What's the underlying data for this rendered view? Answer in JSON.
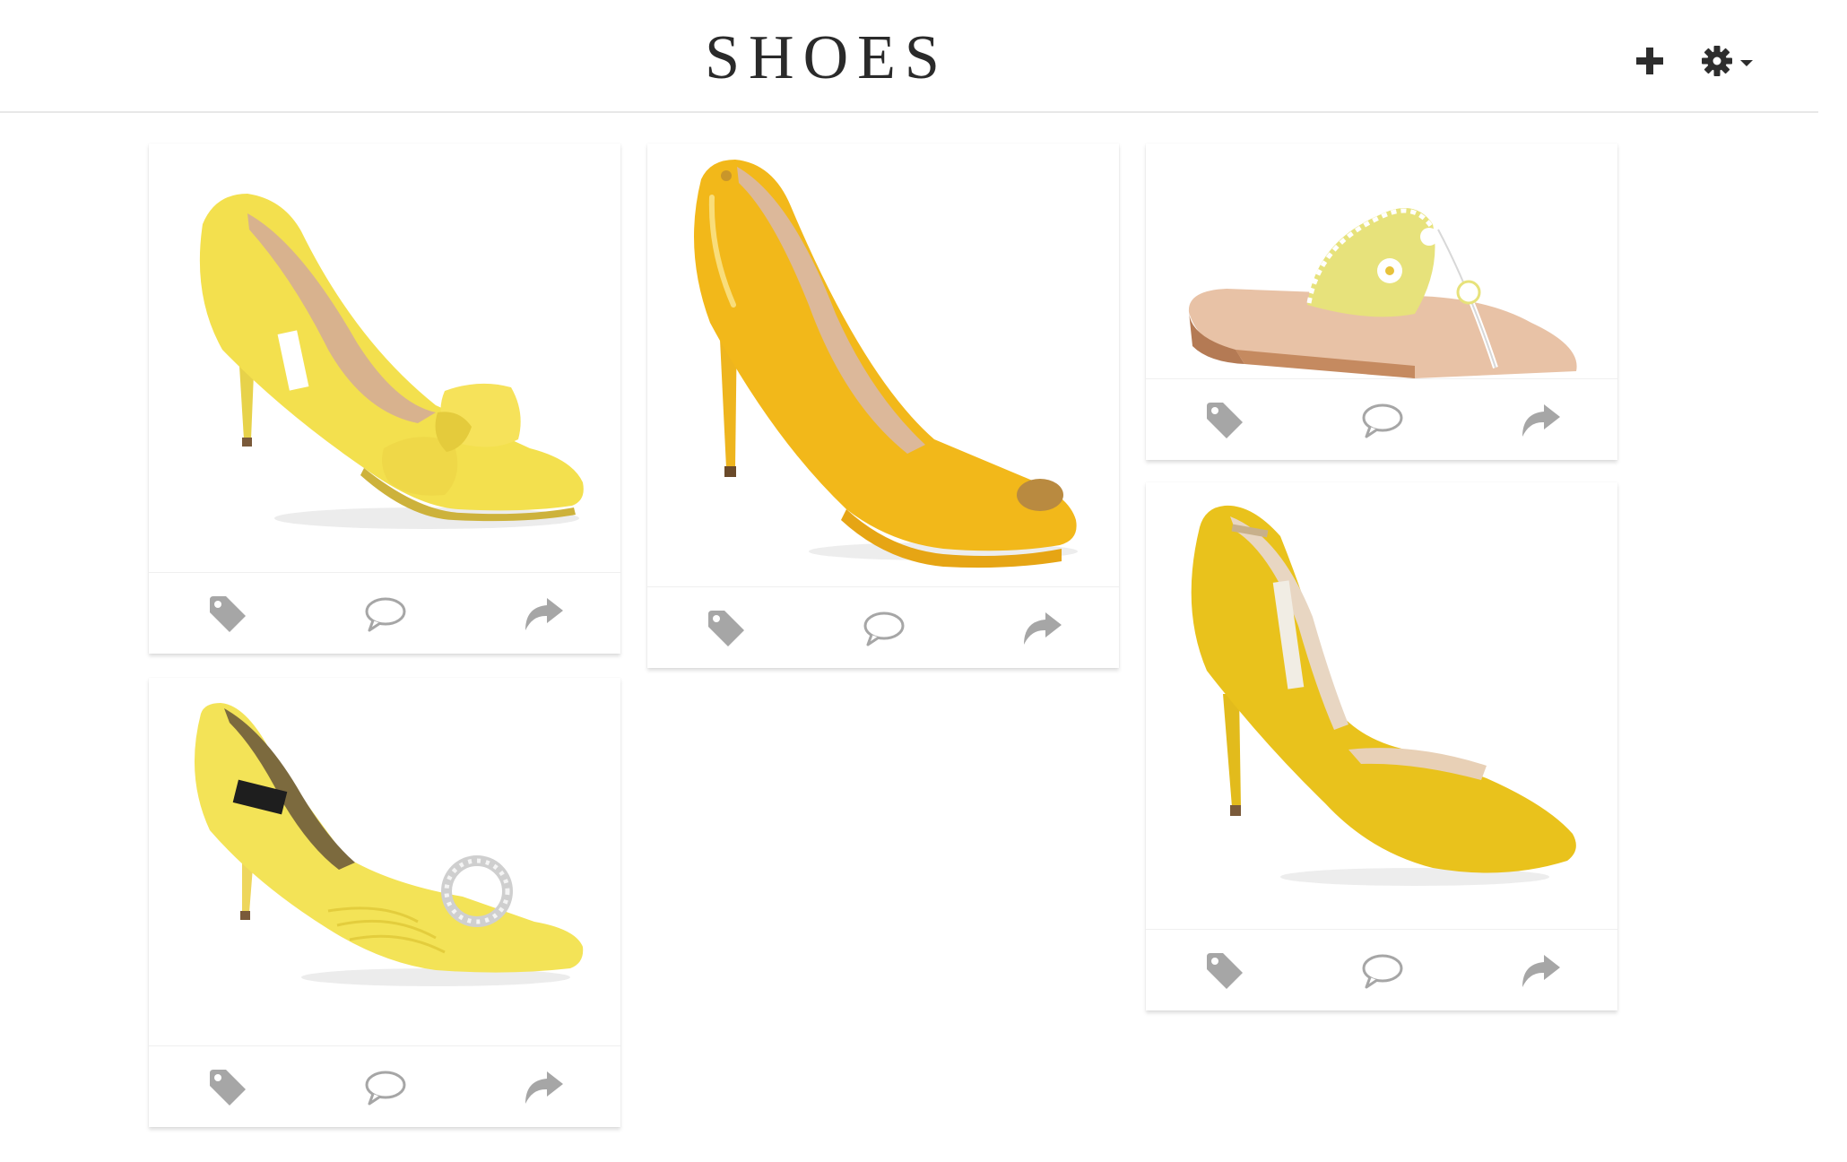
{
  "header": {
    "title": "SHOES",
    "add_icon": "plus-icon",
    "settings_icon": "gear-icon",
    "settings_caret_icon": "caret-down-icon"
  },
  "cards": [
    {
      "name": "yellow-bow-peep-toe-pump",
      "color": "#f3e04e",
      "actions": [
        "tag-icon",
        "comment-icon",
        "share-icon"
      ]
    },
    {
      "name": "yellow-patent-platform-pump",
      "color": "#f1b81b",
      "actions": [
        "tag-icon",
        "comment-icon",
        "share-icon"
      ]
    },
    {
      "name": "yellow-white-thong-sandal",
      "color": "#e7e27b",
      "actions": [
        "tag-icon",
        "comment-icon",
        "share-icon"
      ]
    },
    {
      "name": "yellow-jeweled-dorsay-pump",
      "color": "#f3e357",
      "actions": [
        "tag-icon",
        "comment-icon",
        "share-icon"
      ]
    },
    {
      "name": "yellow-suede-dorsay-pump",
      "color": "#e9c21c",
      "actions": [
        "tag-icon",
        "comment-icon",
        "share-icon"
      ]
    }
  ],
  "colors": {
    "icon_gray": "#a6a6a6",
    "header_icon": "#2d2d2d",
    "title": "#2a2a2a"
  }
}
